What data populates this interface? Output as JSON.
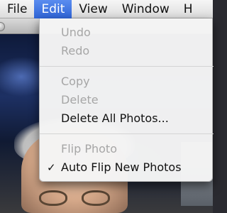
{
  "menubar": {
    "items": [
      {
        "label": "File"
      },
      {
        "label": "Edit"
      },
      {
        "label": "View"
      },
      {
        "label": "Window"
      },
      {
        "label": "H"
      }
    ],
    "active_index": 1,
    "accent_color": "#2f64d6"
  },
  "edit_menu": {
    "items": [
      {
        "label": "Undo",
        "enabled": false
      },
      {
        "label": "Redo",
        "enabled": false
      },
      {
        "label": "Copy",
        "enabled": false
      },
      {
        "label": "Delete",
        "enabled": false
      },
      {
        "label": "Delete All Photos...",
        "enabled": true
      },
      {
        "label": "Flip Photo",
        "enabled": false
      },
      {
        "label": "Auto Flip New Photos",
        "enabled": true,
        "checked": true,
        "check_glyph": "✓"
      }
    ]
  }
}
